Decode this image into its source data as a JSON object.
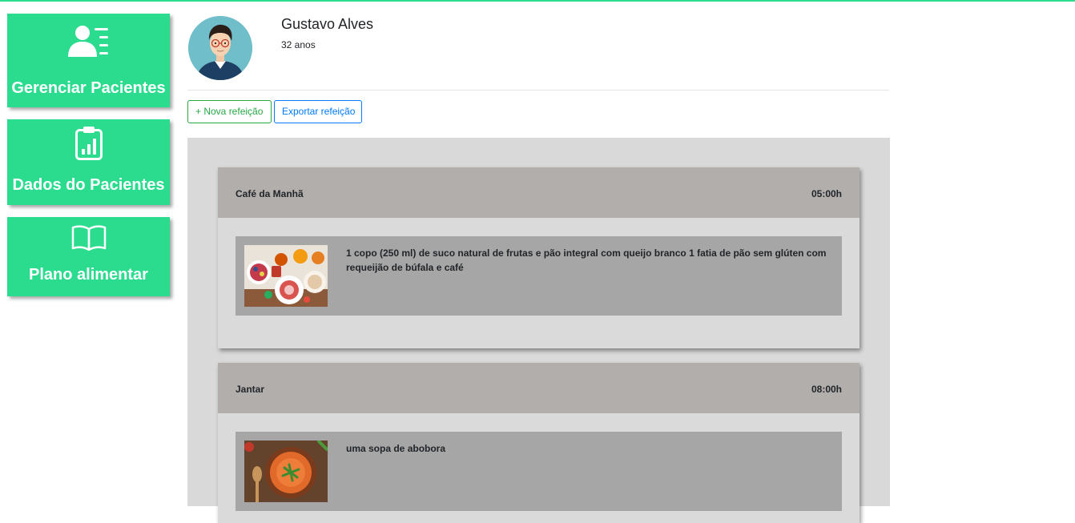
{
  "sidebar": {
    "items": [
      {
        "label": "Gerenciar Pacientes",
        "icon": "patient-list-icon"
      },
      {
        "label": "Dados do Pacientes",
        "icon": "clipboard-chart-icon"
      },
      {
        "label": "Plano alimentar",
        "icon": "open-book-icon"
      }
    ]
  },
  "patient": {
    "name": "Gustavo Alves",
    "age": "32 anos"
  },
  "toolbar": {
    "new_meal_label": "+ Nova refeição",
    "export_meal_label": "Exportar refeição"
  },
  "meals": [
    {
      "title": "Café da Manhã",
      "time": "05:00h",
      "description": "1 copo (250 ml) de suco natural de frutas e pão integral com queijo branco 1 fatia de pão sem glúten com requeijão de búfala e café",
      "image": "breakfast-photo"
    },
    {
      "title": "Jantar",
      "time": "08:00h",
      "description": "uma sopa de abobora",
      "image": "pumpkin-soup-photo"
    }
  ],
  "colors": {
    "accent": "#2bdc8f",
    "success": "#28a745",
    "primary": "#007bff",
    "panel_bg": "#d9d9d9",
    "meal_header": "#b2aeac",
    "meal_item": "#a6a6a6"
  }
}
